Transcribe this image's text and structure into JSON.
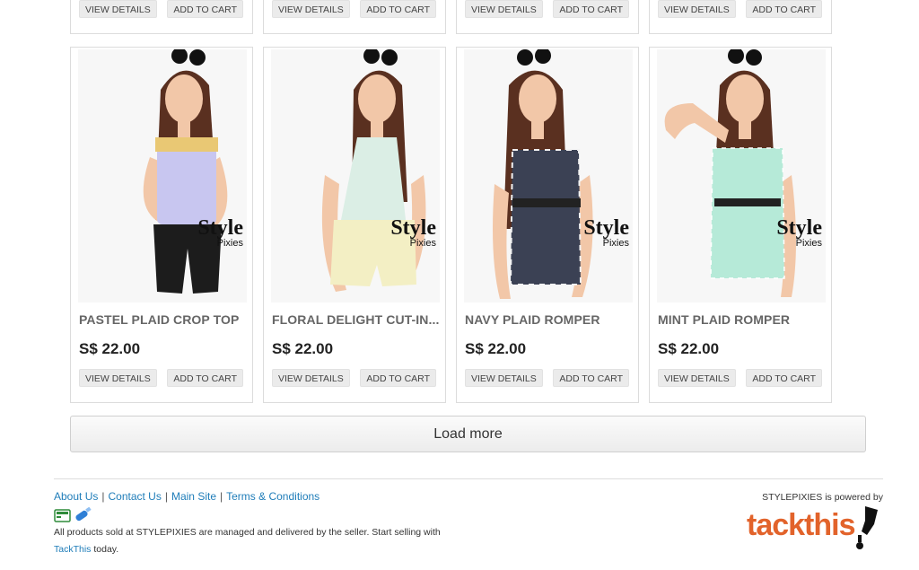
{
  "buttons": {
    "view_details": "VIEW DETAILS",
    "add_to_cart": "ADD TO CART"
  },
  "watermark": {
    "line1": "Style",
    "line2": "Pixies"
  },
  "products": [
    {
      "title": "PASTEL PLAID CROP TOP",
      "price": "S$ 22.00"
    },
    {
      "title": "FLORAL DELIGHT CUT-IN...",
      "price": "S$ 22.00"
    },
    {
      "title": "NAVY PLAID ROMPER",
      "price": "S$ 22.00"
    },
    {
      "title": "MINT PLAID ROMPER",
      "price": "S$ 22.00"
    }
  ],
  "load_more": "Load more",
  "footer": {
    "links": [
      "About Us",
      "Contact Us",
      "Main Site",
      "Terms & Conditions"
    ],
    "separator": "|",
    "disclaimer": "All products sold at STYLEPIXIES are managed and delivered by the seller.  Start selling with",
    "tackthis_link": "TackThis",
    "disclaimer_end": " today.",
    "powered_by": "STYLEPIXIES is powered by",
    "logo_text": "tackthis"
  },
  "colors": {
    "link": "#1f7db9",
    "logo": "#e2632b",
    "top1": "#c8c6f0",
    "shorts1": "#1c1c1c",
    "top2": "#dbeee5",
    "shorts2": "#f3efc4",
    "top3": "#3b4154",
    "top4": "#b6ead8"
  }
}
